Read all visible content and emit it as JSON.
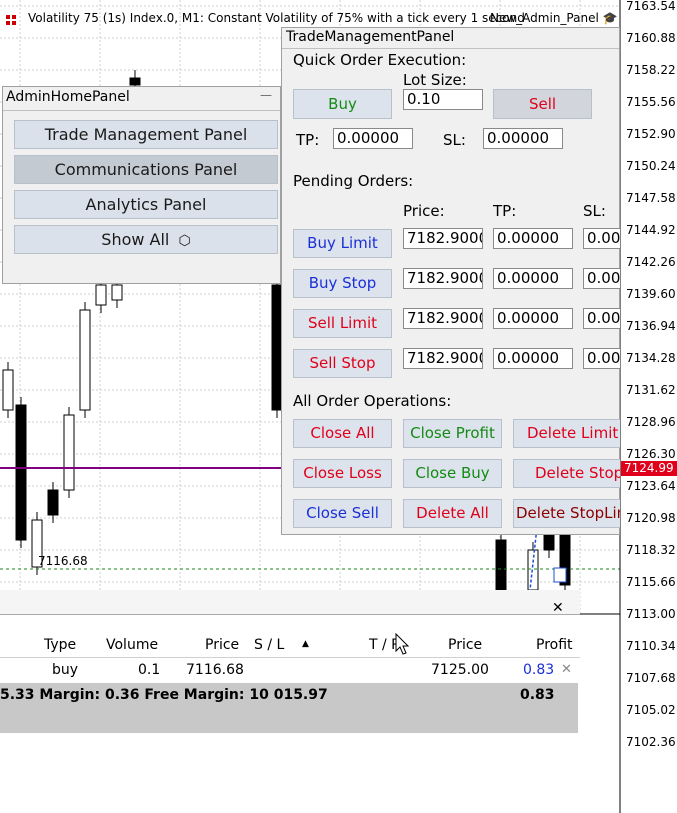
{
  "chart": {
    "title": "Volatility 75 (1s) Index.0, M1:  Constant Volatility of 75% with a tick every 1 second",
    "price_ticks": [
      "7163.54",
      "7160.88",
      "7158.22",
      "7155.56",
      "7152.90",
      "7150.24",
      "7147.58",
      "7144.92",
      "7142.26",
      "7139.60",
      "7136.94",
      "7134.28",
      "7131.62",
      "7128.96",
      "7126.30",
      "7123.64",
      "7120.98",
      "7118.32",
      "7115.66",
      "7113.00",
      "7110.34",
      "7107.68",
      "7105.02",
      "7102.36"
    ],
    "current_price": "7124.99",
    "entry_label": "7116.68",
    "colors": {
      "bid_line": "#800080",
      "price_tag": "#e0001a",
      "grid": "#c8c8c8"
    }
  },
  "admin_panel": {
    "title": "AdminHomePanel",
    "minimize_label": "—",
    "buttons": [
      "Trade Management Panel",
      "Communications Panel",
      "Analytics Panel",
      "Show All"
    ],
    "show_all_icon": "hexagon-icon"
  },
  "trade_panel": {
    "title": "TradeManagementPanel",
    "quick_order_header": "Quick Order Execution:",
    "lot_size_label": "Lot Size:",
    "lot_size_value": "0.10",
    "buy_label": "Buy",
    "sell_label": "Sell",
    "tp_label": "TP:",
    "tp_value": "0.00000",
    "sl_label": "SL:",
    "sl_value": "0.00000",
    "pending_header": "Pending Orders:",
    "col_price": "Price:",
    "col_tp": "TP:",
    "col_sl": "SL:",
    "pending_rows": [
      {
        "label": "Buy Limit",
        "price": "7182.9000",
        "tp": "0.00000",
        "sl": "0.00"
      },
      {
        "label": "Buy Stop",
        "price": "7182.9000",
        "tp": "0.00000",
        "sl": "0.00"
      },
      {
        "label": "Sell Limit",
        "price": "7182.9000",
        "tp": "0.00000",
        "sl": "0.00"
      },
      {
        "label": "Sell Stop",
        "price": "7182.9000",
        "tp": "0.00000",
        "sl": "0.00"
      }
    ],
    "all_ops_header": "All Order Operations:",
    "ops": [
      "Close All",
      "Close Profit",
      "Delete Limit",
      "Close Loss",
      "Close Buy",
      "Delete Stop",
      "Close Sell",
      "Delete All",
      "Delete StopLim"
    ]
  },
  "window_badge": {
    "label": "New_Admin_Panel",
    "icon": "graduation-cap-icon"
  },
  "toolbox": {
    "close_label": "✕",
    "headers": [
      "Type",
      "Volume",
      "Price",
      "S / L",
      "T / P",
      "Price",
      "Profit"
    ],
    "row": {
      "type": "buy",
      "volume": "0.1",
      "price": "7116.68",
      "current_price": "7125.00",
      "profit": "0.83"
    },
    "summary_left": "5.33  Margin: 0.36  Free Margin: 10 015.97",
    "summary_right": "0.83"
  }
}
